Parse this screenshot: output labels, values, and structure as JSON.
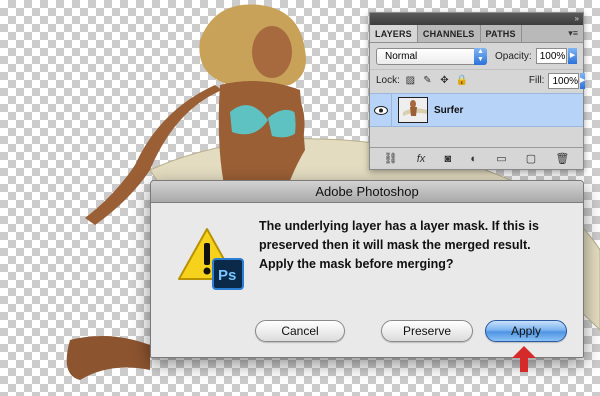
{
  "layers_panel": {
    "tabs": [
      "LAYERS",
      "CHANNELS",
      "PATHS"
    ],
    "blend_mode": "Normal",
    "opacity_label": "Opacity:",
    "opacity_value": "100%",
    "lock_label": "Lock:",
    "fill_label": "Fill:",
    "fill_value": "100%",
    "layer_name": "Surfer"
  },
  "dialog": {
    "title": "Adobe Photoshop",
    "message": "The underlying layer has a layer mask. If this is preserved then it will mask the merged result. Apply the mask before merging?",
    "buttons": {
      "cancel": "Cancel",
      "preserve": "Preserve",
      "apply": "Apply"
    }
  },
  "colors": {
    "selection": "#b7d3f7",
    "accent": "#4f93e3",
    "arrow": "#d62a2a"
  },
  "icons": [
    "eye-icon",
    "warning-icon",
    "photoshop-icon",
    "lock-icon",
    "brush-icon",
    "move-icon",
    "link-icon",
    "fx-icon",
    "mask-icon",
    "adjustment-icon",
    "folder-icon",
    "new-layer-icon",
    "trash-icon",
    "panel-menu-icon"
  ]
}
